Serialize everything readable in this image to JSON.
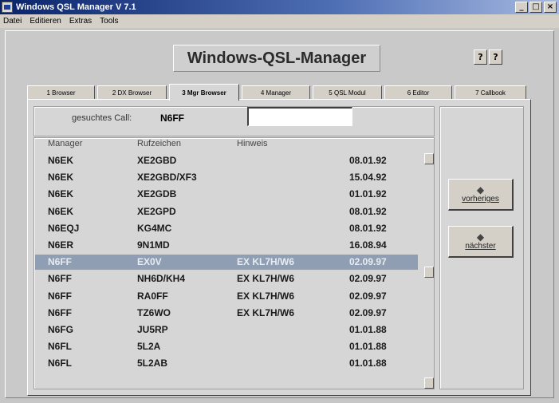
{
  "window": {
    "title": "Windows QSL Manager V 7.1",
    "controls": [
      "_",
      "□",
      "×"
    ]
  },
  "menu": [
    "Datei",
    "Editieren",
    "Extras",
    "Tools"
  ],
  "app_title": "Windows-QSL-Manager",
  "help_buttons": [
    "?",
    "?"
  ],
  "tabs": [
    {
      "label": "1 Browser",
      "active": false
    },
    {
      "label": "2 DX Browser",
      "active": false
    },
    {
      "label": "3 Mgr Browser",
      "active": true
    },
    {
      "label": "4 Manager",
      "active": false
    },
    {
      "label": "5 QSL Modul",
      "active": false
    },
    {
      "label": "6 Editor",
      "active": false
    },
    {
      "label": "7 Callbook",
      "active": false
    }
  ],
  "search": {
    "label": "gesuchtes Call:",
    "call": "N6FF",
    "input_value": ""
  },
  "columns": [
    "Manager",
    "Rufzeichen",
    "Hinweis"
  ],
  "rows": [
    {
      "manager": "N6EK",
      "call": "XE2GBD",
      "note": "",
      "date": "08.01.92",
      "selected": false
    },
    {
      "manager": "N6EK",
      "call": "XE2GBD/XF3",
      "note": "",
      "date": "15.04.92",
      "selected": false
    },
    {
      "manager": "N6EK",
      "call": "XE2GDB",
      "note": "",
      "date": "01.01.92",
      "selected": false
    },
    {
      "manager": "N6EK",
      "call": "XE2GPD",
      "note": "",
      "date": "08.01.92",
      "selected": false
    },
    {
      "manager": "N6EQJ",
      "call": "KG4MC",
      "note": "",
      "date": "08.01.92",
      "selected": false
    },
    {
      "manager": "N6ER",
      "call": "9N1MD",
      "note": "",
      "date": "16.08.94",
      "selected": false
    },
    {
      "manager": "N6FF",
      "call": "EX0V",
      "note": "EX KL7H/W6",
      "date": "02.09.97",
      "selected": true
    },
    {
      "manager": "N6FF",
      "call": "NH6D/KH4",
      "note": "EX KL7H/W6",
      "date": "02.09.97",
      "selected": false
    },
    {
      "manager": "N6FF",
      "call": "RA0FF",
      "note": "EX KL7H/W6",
      "date": "02.09.97",
      "selected": false
    },
    {
      "manager": "N6FF",
      "call": "TZ6WO",
      "note": "EX KL7H/W6",
      "date": "02.09.97",
      "selected": false
    },
    {
      "manager": "N6FG",
      "call": "JU5RP",
      "note": "",
      "date": "01.01.88",
      "selected": false
    },
    {
      "manager": "N6FL",
      "call": "5L2A",
      "note": "",
      "date": "01.01.88",
      "selected": false
    },
    {
      "manager": "N6FL",
      "call": "5L2AB",
      "note": "",
      "date": "01.01.88",
      "selected": false
    }
  ],
  "nav": {
    "prev_label": "vorheriges",
    "next_label": "nächster",
    "prev_icon": "arrow-left-icon",
    "next_icon": "arrow-right-icon"
  },
  "colors": {
    "selected_row": "#8f9eb2",
    "titlebar": "#0a246a"
  }
}
